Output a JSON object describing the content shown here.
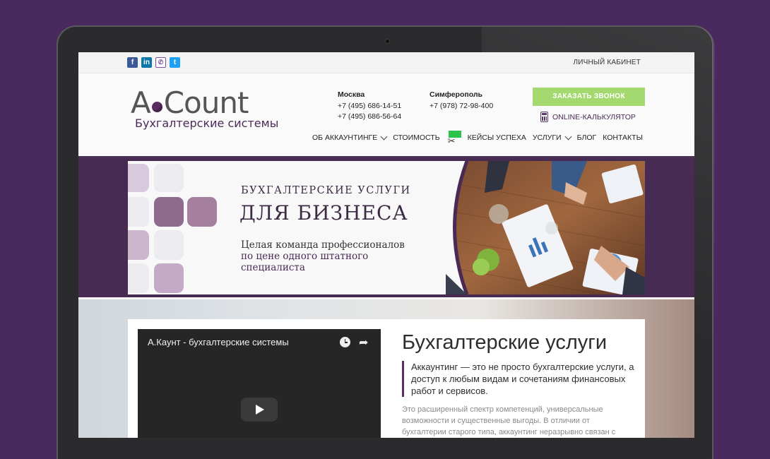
{
  "colors": {
    "background": "#4a2a5e",
    "accent": "#5b2b63",
    "cta": "#a4d96f"
  },
  "topbar": {
    "socials": [
      {
        "icon": "facebook-icon",
        "glyph": "f"
      },
      {
        "icon": "linkedin-icon",
        "glyph": "in"
      },
      {
        "icon": "viber-icon",
        "glyph": "✆"
      },
      {
        "icon": "twitter-icon",
        "glyph": "t"
      }
    ],
    "cabinet": "ЛИЧНЫЙ КАБИНЕТ"
  },
  "logo": {
    "main_a": "A",
    "main_rest": "Count",
    "sub": "Бухгалтерские системы"
  },
  "contacts": {
    "moscow": {
      "city": "Москва",
      "phone1": "+7 (495) 686-14-51",
      "phone2": "+7 (495) 686-56-64"
    },
    "simferopol": {
      "city": "Симферополь",
      "phone1": "+7 (978) 72-98-400"
    }
  },
  "call_button": "ЗАКАЗАТЬ ЗВОНОК",
  "calculator": {
    "icon": "calculator-icon",
    "label": "ONLINE-КАЛЬКУЛЯТОР"
  },
  "nav": {
    "about": "ОБ АККАУНТИНГЕ",
    "price": "СТОИМОСТЬ",
    "cases": "КЕЙСЫ УСПЕХА",
    "services": "УСЛУГИ",
    "blog": "БЛОГ",
    "contacts": "КОНТАКТЫ"
  },
  "banner": {
    "subtitle": "БУХГАЛТЕРСКИЕ УСЛУГИ",
    "title": "ДЛЯ БИЗНЕСА",
    "line1": "Целая команда профессионалов",
    "line2": "по цене одного штатного",
    "line3": "специалиста"
  },
  "video": {
    "title": "А.Каунт - бухгалтерские системы"
  },
  "content": {
    "heading": "Бухгалтерские услуги",
    "quote": "Аккаунтинг — это не просто бухгалтерские услуги, а доступ к любым видам и сочетаниям финансовых работ и сервисов.",
    "paragraph": "Это расширенный спектр компетенций, универсальные возможности и существенные выгоды. В отличии от бухгалтерии старого типа, аккаунтинг неразрывно связан с"
  }
}
